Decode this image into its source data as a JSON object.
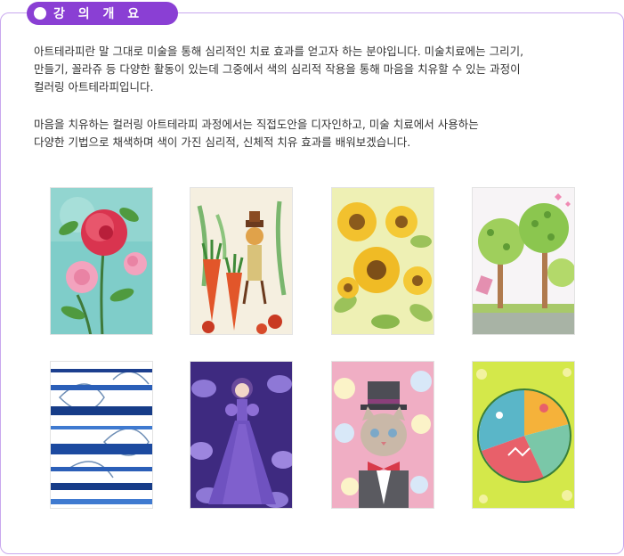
{
  "section": {
    "title": "강 의 개 요",
    "accent_color": "#8a3fd4",
    "border_color": "#c9a8ee"
  },
  "paragraphs": [
    "   아트테라피란 말 그대로 미술을 통해 심리적인 치료 효과를 얻고자 하는 분야입니다. 미술치료에는 그리기,\n만들기, 꼴라쥬 등 다양한 활동이 있는데 그중에서 색의 심리적 작용을 통해 마음을 치유할 수 있는 과정이\n컬러링 아트테라피입니다.",
    "   마음을 치유하는 컬러링 아트테라피 과정에서는 직접도안을 디자인하고, 미술 치료에서 사용하는\n다양한 기법으로 채색하며 색이 가진 심리적, 신체적 치유 효과를 배워보겠습니다."
  ],
  "gallery": [
    {
      "subject": "peony-flowers-painting"
    },
    {
      "subject": "carrot-scarecrow-painting"
    },
    {
      "subject": "sunflowers-painting"
    },
    {
      "subject": "polka-dot-trees-painting"
    },
    {
      "subject": "blue-stripe-leaves-painting"
    },
    {
      "subject": "purple-dress-girl-painting"
    },
    {
      "subject": "cat-in-top-hat-painting"
    },
    {
      "subject": "mandala-circle-painting"
    }
  ]
}
